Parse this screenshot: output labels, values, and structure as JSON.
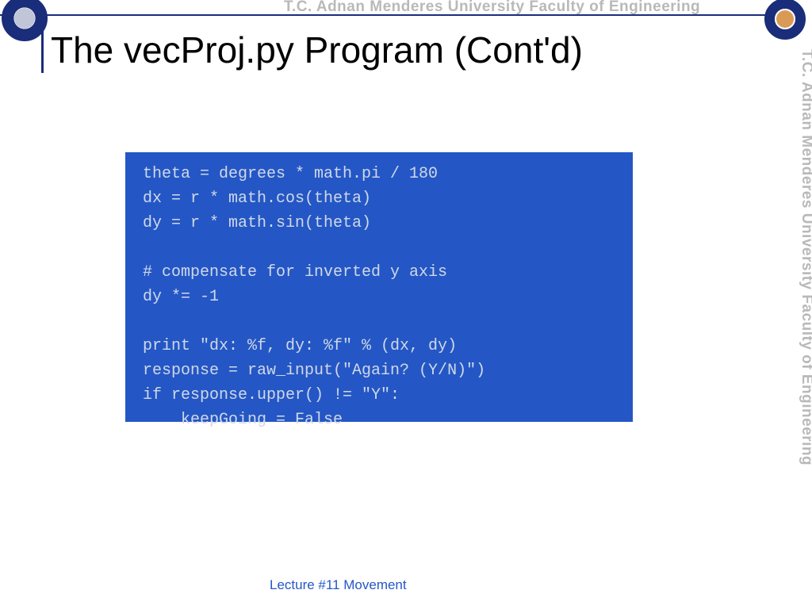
{
  "header": {
    "org_text_top": "T.C.   Adnan Menderes University   Faculty of Engineering",
    "org_text_side": "T.C.   Adnan Menderes University   Faculty of Engineering"
  },
  "slide": {
    "title": "The vecProj.py Program (Cont'd)",
    "footer": "Lecture #11 Movement"
  },
  "code": {
    "content": "theta = degrees * math.pi / 180\ndx = r * math.cos(theta)\ndy = r * math.sin(theta)\n\n# compensate for inverted y axis\ndy *= -1\n\nprint \"dx: %f, dy: %f\" % (dx, dy)\nresponse = raw_input(\"Again? (Y/N)\")\nif response.upper() != \"Y\":\n    keepGoing = False"
  }
}
